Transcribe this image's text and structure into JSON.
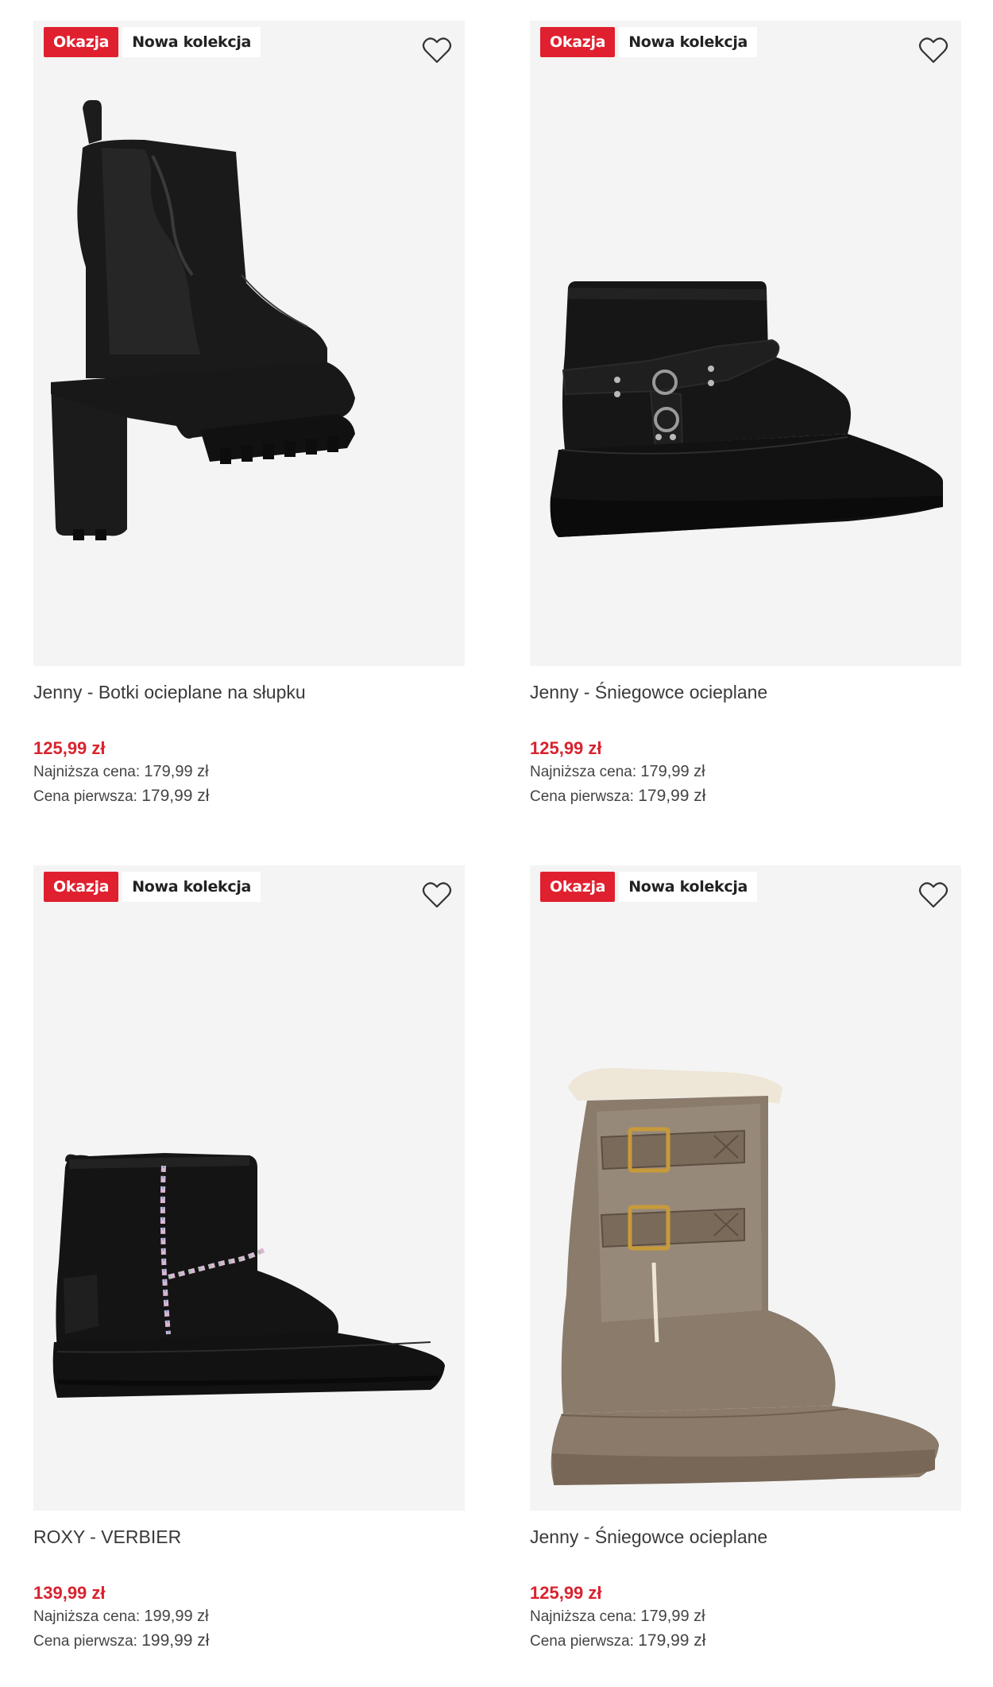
{
  "products": [
    {
      "badges": {
        "sale": "Okazja",
        "new": "Nowa kolekcja"
      },
      "title": "Jenny - Botki ocieplane na słupku",
      "price": "125,99 zł",
      "lowest_label": "Najniższa cena:",
      "lowest_value": "179,99 zł",
      "first_label": "Cena pierwsza:",
      "first_value": "179,99 zł",
      "image_icon": "black-heeled-ankle-boot"
    },
    {
      "badges": {
        "sale": "Okazja",
        "new": "Nowa kolekcja"
      },
      "title": "Jenny - Śniegowce ocieplane",
      "price": "125,99 zł",
      "lowest_label": "Najniższa cena:",
      "lowest_value": "179,99 zł",
      "first_label": "Cena pierwsza:",
      "first_value": "179,99 zł",
      "image_icon": "black-platform-snow-boot-with-harness"
    },
    {
      "badges": {
        "sale": "Okazja",
        "new": "Nowa kolekcja"
      },
      "title": "ROXY - VERBIER",
      "price": "139,99 zł",
      "lowest_label": "Najniższa cena:",
      "lowest_value": "199,99 zł",
      "first_label": "Cena pierwsza:",
      "first_value": "199,99 zł",
      "image_icon": "black-mini-boot-with-stitching"
    },
    {
      "badges": {
        "sale": "Okazja",
        "new": "Nowa kolekcja"
      },
      "title": "Jenny - Śniegowce ocieplane",
      "price": "125,99 zł",
      "lowest_label": "Najniższa cena:",
      "lowest_value": "179,99 zł",
      "first_label": "Cena pierwsza:",
      "first_value": "179,99 zł",
      "image_icon": "taupe-buckle-snow-boot"
    }
  ],
  "colors": {
    "sale_badge": "#e0202f",
    "price": "#d8232f",
    "image_background": "#f4f4f4"
  },
  "icons": {
    "favorite": "heart-outline-icon"
  }
}
